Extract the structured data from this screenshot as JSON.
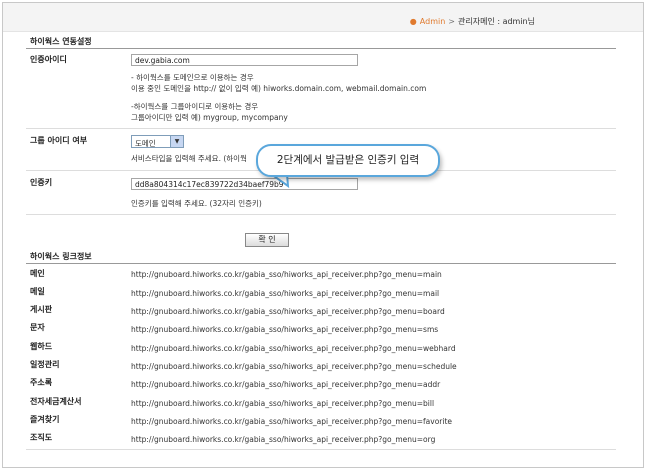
{
  "breadcrumb": {
    "admin": "Admin",
    "separator": ">",
    "current": "관리자메인 : admin님"
  },
  "settings": {
    "section_title": "하이웍스 연동설정",
    "auth_id": {
      "label": "인증아이디",
      "value": "dev.gabia.com",
      "help_domain_1": "- 하이웍스를 도메인으로 이용하는 경우",
      "help_domain_2": "이용 중인 도메인을 http:// 없이 입력 예) hiworks.domain.com, webmail.domain.com",
      "help_group_1": "-하이웍스를 그룹아이디로 이용하는 경우",
      "help_group_2": "그룹아이디만 입력 예) mygroup, mycompany"
    },
    "group_id": {
      "label": "그룹 아이디 여부",
      "selected": "도메인",
      "help": "서비스타입을 입력해 주세요. (하이웍"
    },
    "auth_key": {
      "label": "인증키",
      "value": "dd8a804314c17ec839722d34baef79b9",
      "help": "인증키를 입력해 주세요. (32자리 인증키)"
    },
    "callout": "2단계에서 발급받은 인증키 입력",
    "confirm_label": "확 인"
  },
  "links": {
    "section_title": "하이웍스 링크정보",
    "rows": [
      {
        "label": "메인",
        "url": "http://gnuboard.hiworks.co.kr/gabia_sso/hiworks_api_receiver.php?go_menu=main"
      },
      {
        "label": "메일",
        "url": "http://gnuboard.hiworks.co.kr/gabia_sso/hiworks_api_receiver.php?go_menu=mail"
      },
      {
        "label": "게시판",
        "url": "http://gnuboard.hiworks.co.kr/gabia_sso/hiworks_api_receiver.php?go_menu=board"
      },
      {
        "label": "문자",
        "url": "http://gnuboard.hiworks.co.kr/gabia_sso/hiworks_api_receiver.php?go_menu=sms"
      },
      {
        "label": "웹하드",
        "url": "http://gnuboard.hiworks.co.kr/gabia_sso/hiworks_api_receiver.php?go_menu=webhard"
      },
      {
        "label": "일정관리",
        "url": "http://gnuboard.hiworks.co.kr/gabia_sso/hiworks_api_receiver.php?go_menu=schedule"
      },
      {
        "label": "주소록",
        "url": "http://gnuboard.hiworks.co.kr/gabia_sso/hiworks_api_receiver.php?go_menu=addr"
      },
      {
        "label": "전자세금계산서",
        "url": "http://gnuboard.hiworks.co.kr/gabia_sso/hiworks_api_receiver.php?go_menu=bill"
      },
      {
        "label": "즐겨찾기",
        "url": "http://gnuboard.hiworks.co.kr/gabia_sso/hiworks_api_receiver.php?go_menu=favorite"
      },
      {
        "label": "조직도",
        "url": "http://gnuboard.hiworks.co.kr/gabia_sso/hiworks_api_receiver.php?go_menu=org"
      }
    ]
  }
}
